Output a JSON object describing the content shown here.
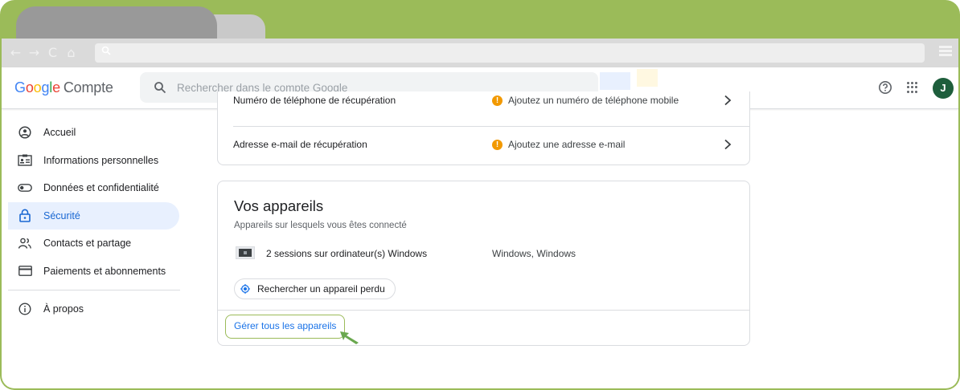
{
  "browser": {
    "nav_icons": [
      "←",
      "→",
      "C",
      "⌂"
    ]
  },
  "header": {
    "logo": {
      "g1": "G",
      "o1": "o",
      "o2": "o",
      "g2": "g",
      "l": "l",
      "e": "e",
      "rest": "Compte"
    },
    "search_placeholder": "Rechercher dans le compte Google",
    "avatar_initial": "J"
  },
  "sidebar": {
    "items": [
      {
        "label": "Accueil",
        "icon": "account-circle-icon"
      },
      {
        "label": "Informations personnelles",
        "icon": "id-card-icon"
      },
      {
        "label": "Données et confidentialité",
        "icon": "toggle-icon"
      },
      {
        "label": "Sécurité",
        "icon": "lock-icon",
        "active": true
      },
      {
        "label": "Contacts et partage",
        "icon": "people-icon"
      },
      {
        "label": "Paiements et abonnements",
        "icon": "credit-card-icon"
      }
    ],
    "about": {
      "label": "À propos",
      "icon": "info-icon"
    }
  },
  "recovery": {
    "phone": {
      "label": "Numéro de téléphone de récupération",
      "value": "Ajoutez un numéro de téléphone mobile"
    },
    "email": {
      "label": "Adresse e-mail de récupération",
      "value": "Ajoutez une adresse e-mail"
    }
  },
  "devices": {
    "title": "Vos appareils",
    "subtitle": "Appareils sur lesquels vous êtes connecté",
    "items": [
      {
        "name": "2 sessions sur ordinateur(s) Windows",
        "os": "Windows, Windows"
      }
    ],
    "find_label": "Rechercher un appareil perdu",
    "manage_label": "Gérer tous les appareils"
  },
  "colors": {
    "frame": "#9bbb59",
    "accent": "#1a73e8",
    "warning": "#f29900",
    "avatar": "#1e5e3c"
  }
}
